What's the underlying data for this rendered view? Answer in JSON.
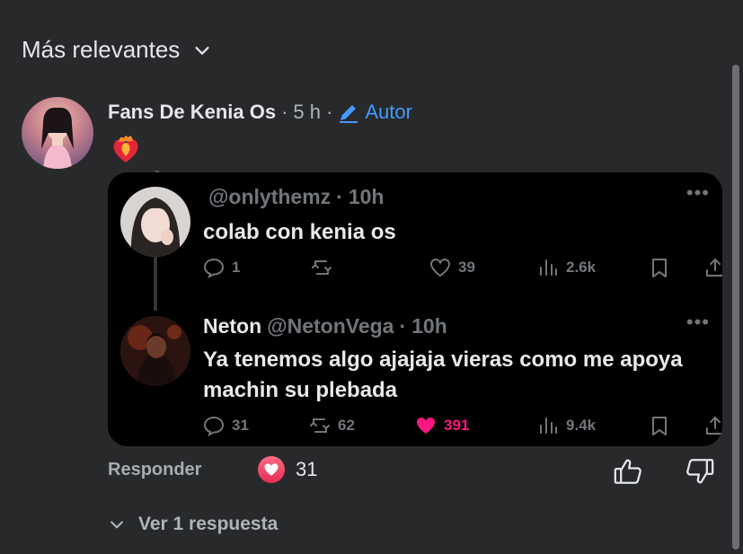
{
  "sort": {
    "label": "Más relevantes"
  },
  "comment": {
    "author": "Fans De Kenia Os",
    "time": "5 h",
    "separator": "·",
    "badge": "Autor",
    "emoji": "❤️‍🔥",
    "embed": {
      "tweets": [
        {
          "display_name": "",
          "handle": "@onlythemz",
          "time": "10h",
          "text": "colab con kenia os",
          "replies": "1",
          "retweets": "",
          "likes": "39",
          "liked": false,
          "views": "2.6k"
        },
        {
          "display_name": "Neton",
          "handle": "@NetonVega",
          "time": "10h",
          "text": "Ya tenemos algo ajajaja vieras como me apoya machin su plebada",
          "replies": "31",
          "retweets": "62",
          "likes": "391",
          "liked": true,
          "views": "9.4k"
        }
      ]
    },
    "actions": {
      "reply_label": "Responder",
      "reaction_count": "31"
    },
    "view_replies_label": "Ver 1 respuesta"
  },
  "colors": {
    "background": "#28292b",
    "link_blue": "#4599ff",
    "like_pink": "#f91880",
    "embed_bg": "#000000"
  }
}
